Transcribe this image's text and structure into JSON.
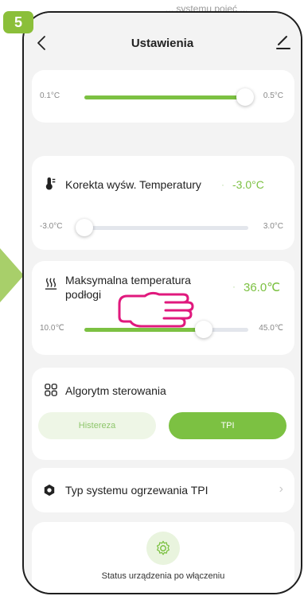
{
  "top_snippet": "... systemu pojęć ...",
  "step_badge": "5",
  "header": {
    "title": "Ustawienia",
    "back_icon": "chevron-left-icon",
    "edit_icon": "pencil-icon"
  },
  "range_slider": {
    "min_label": "0.1°C",
    "max_label": "0.5°C",
    "value_fraction": 0.98
  },
  "display_correction": {
    "icon": "thermometer-icon",
    "label": "Korekta wyśw. Temperatury",
    "value": "-3.0°C",
    "min_label": "-3.0°C",
    "max_label": "3.0°C",
    "value_fraction": 0.0
  },
  "floor_max_temp": {
    "icon": "heat-waves-icon",
    "label_line1": "Maksymalna temperatura",
    "label_line2": "podłogi",
    "value": "36.0℃",
    "min_label": "10.0℃",
    "max_label": "45.0℃",
    "value_fraction": 0.73
  },
  "algorithm": {
    "icon": "grid-icon",
    "label": "Algorytm sterowania",
    "options": [
      "Histereza",
      "TPI"
    ],
    "selected": "TPI"
  },
  "tpi_system": {
    "icon": "gear-hex-icon",
    "label": "Typ systemu ogrzewania TPI",
    "chevron": "›"
  },
  "power_on_status": {
    "icon": "gear-icon",
    "label": "Status urządzenia po włączeniu"
  },
  "colors": {
    "accent": "#7cc142",
    "badge": "#8bbf3a",
    "hand": "#e0197d",
    "arrow": "#a8cf6a"
  }
}
